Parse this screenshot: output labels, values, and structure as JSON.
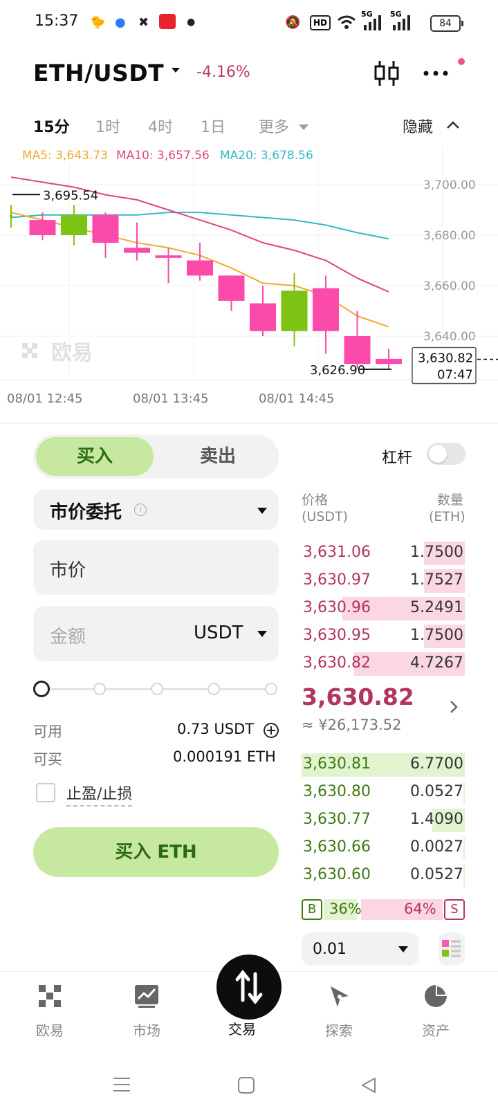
{
  "status_bar": {
    "time": "15:37",
    "hd": "HD",
    "net1": "5G",
    "net2": "5G",
    "battery": "84"
  },
  "header": {
    "pair": "ETH/USDT",
    "change": "-4.16%"
  },
  "timeframes": {
    "items": [
      "15分",
      "1时",
      "4时",
      "1日",
      "更多"
    ],
    "active": "15分",
    "hide_label": "隐藏"
  },
  "chart_data": {
    "type": "candlestick",
    "ma": {
      "ma5": "MA5: 3,643.73",
      "ma10": "MA10: 3,657.56",
      "ma20": "MA20: 3,678.56"
    },
    "ma_colors": {
      "ma5": "#f0a830",
      "ma10": "#e0457b",
      "ma20": "#33b8c8"
    },
    "y_ticks": [
      3700,
      3680,
      3660,
      3640
    ],
    "y_tick_labels": [
      "3,700.00",
      "3,680.00",
      "3,660.00",
      "3,640.00"
    ],
    "x_labels": [
      "08/01 12:45",
      "08/01 13:45",
      "08/01 14:45"
    ],
    "high_label": "3,695.54",
    "low_label": "3,626.90",
    "last_price_label": "3,630.82",
    "countdown": "07:47",
    "watermark": "欧易",
    "candles": [
      {
        "o": 3687,
        "c": 3688,
        "h": 3692,
        "l": 3683
      },
      {
        "o": 3686,
        "c": 3680,
        "h": 3689,
        "l": 3678
      },
      {
        "o": 3680,
        "c": 3688,
        "h": 3692,
        "l": 3676
      },
      {
        "o": 3688,
        "c": 3677,
        "h": 3689,
        "l": 3671
      },
      {
        "o": 3675,
        "c": 3673,
        "h": 3685,
        "l": 3670
      },
      {
        "o": 3672,
        "c": 3671,
        "h": 3675,
        "l": 3661
      },
      {
        "o": 3670,
        "c": 3664,
        "h": 3677,
        "l": 3662
      },
      {
        "o": 3664,
        "c": 3654,
        "h": 3664,
        "l": 3650
      },
      {
        "o": 3653,
        "c": 3642,
        "h": 3660,
        "l": 3640
      },
      {
        "o": 3642,
        "c": 3658,
        "h": 3665,
        "l": 3636
      },
      {
        "o": 3659,
        "c": 3642,
        "h": 3664,
        "l": 3633
      },
      {
        "o": 3640,
        "c": 3629,
        "h": 3650,
        "l": 3627
      },
      {
        "o": 3631,
        "c": 3629,
        "h": 3635,
        "l": 3627
      }
    ],
    "ma5_series": [
      3689,
      3686,
      3683,
      3680,
      3677,
      3675,
      3672,
      3667,
      3661,
      3660,
      3656,
      3648,
      3643.73
    ],
    "ma10_series": [
      3703,
      3701,
      3699,
      3696,
      3694,
      3690,
      3686,
      3682,
      3677,
      3674,
      3670,
      3663,
      3657.56
    ],
    "ma20_series": [
      3687,
      3688,
      3688,
      3688,
      3688,
      3689,
      3689,
      3688,
      3687,
      3686,
      3684,
      3681,
      3678.56
    ],
    "ylim": [
      3620,
      3710
    ]
  },
  "trade": {
    "buy_tab": "买入",
    "sell_tab": "卖出",
    "leverage_label": "杠杆",
    "order_type": "市价委托",
    "price_placeholder": "市价",
    "amount_placeholder": "金额",
    "amount_unit": "USDT",
    "available_label": "可用",
    "available_value": "0.73 USDT",
    "buyable_label": "可买",
    "buyable_value": "0.000191 ETH",
    "tp_sl_label": "止盈/止损",
    "buy_button": "买入 ETH"
  },
  "orderbook": {
    "price_header": "价格",
    "price_unit": "(USDT)",
    "qty_header": "数量",
    "qty_unit": "(ETH)",
    "asks": [
      {
        "price": "3,631.06",
        "qty": "1.7500",
        "depth": 0.25
      },
      {
        "price": "3,630.97",
        "qty": "1.7527",
        "depth": 0.25
      },
      {
        "price": "3,630.96",
        "qty": "5.2491",
        "depth": 0.75
      },
      {
        "price": "3,630.95",
        "qty": "1.7500",
        "depth": 0.25
      },
      {
        "price": "3,630.82",
        "qty": "4.7267",
        "depth": 0.68
      }
    ],
    "last_price": "3,630.82",
    "cny_value": "≈ ¥26,173.52",
    "bids": [
      {
        "price": "3,630.81",
        "qty": "6.7700",
        "depth": 1.0
      },
      {
        "price": "3,630.80",
        "qty": "0.0527",
        "depth": 0.01
      },
      {
        "price": "3,630.77",
        "qty": "1.4090",
        "depth": 0.2
      },
      {
        "price": "3,630.66",
        "qty": "0.0027",
        "depth": 0.005
      },
      {
        "price": "3,630.60",
        "qty": "0.0527",
        "depth": 0.01
      }
    ],
    "buy_ratio_label": "B",
    "buy_ratio": "36%",
    "sell_ratio": "64%",
    "sell_ratio_label": "S",
    "precision": "0.01"
  },
  "nav": {
    "items": [
      "欧易",
      "市场",
      "交易",
      "探索",
      "资产"
    ],
    "active": "交易"
  }
}
